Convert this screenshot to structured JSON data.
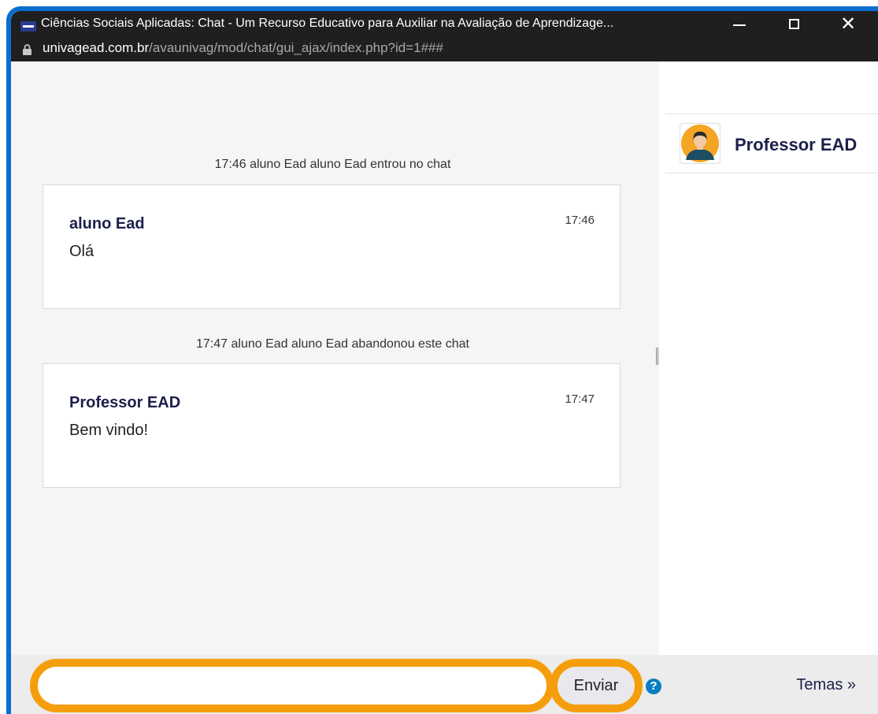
{
  "window": {
    "title": "Ciências Sociais Aplicadas: Chat - Um Recurso Educativo para Auxiliar na Avaliação de Aprendizage...",
    "url_host": "univagead.com.br",
    "url_path": "/avaunivag/mod/chat/gui_ajax/index.php?id=1###",
    "close_glyph": "✕"
  },
  "chat": {
    "events": [
      {
        "text": "17:46 aluno Ead aluno Ead entrou no chat"
      },
      {
        "text": "17:47 aluno Ead aluno Ead abandonou este chat"
      }
    ],
    "messages": [
      {
        "author": "aluno Ead",
        "text": "Olá",
        "time": "17:46"
      },
      {
        "author": "Professor EAD",
        "text": "Bem vindo!",
        "time": "17:47"
      }
    ]
  },
  "users": [
    {
      "name": "Professor EAD",
      "avatar": "user-avatar-icon"
    }
  ],
  "composer": {
    "input_value": "",
    "send_label": "Enviar",
    "help_glyph": "?",
    "themes_label": "Temas »",
    "highlight_color": "#f59e0b"
  },
  "colors": {
    "frame_border": "#0a6ed1",
    "titlebar": "#1f1f1f",
    "author_text": "#1c1f4a"
  }
}
